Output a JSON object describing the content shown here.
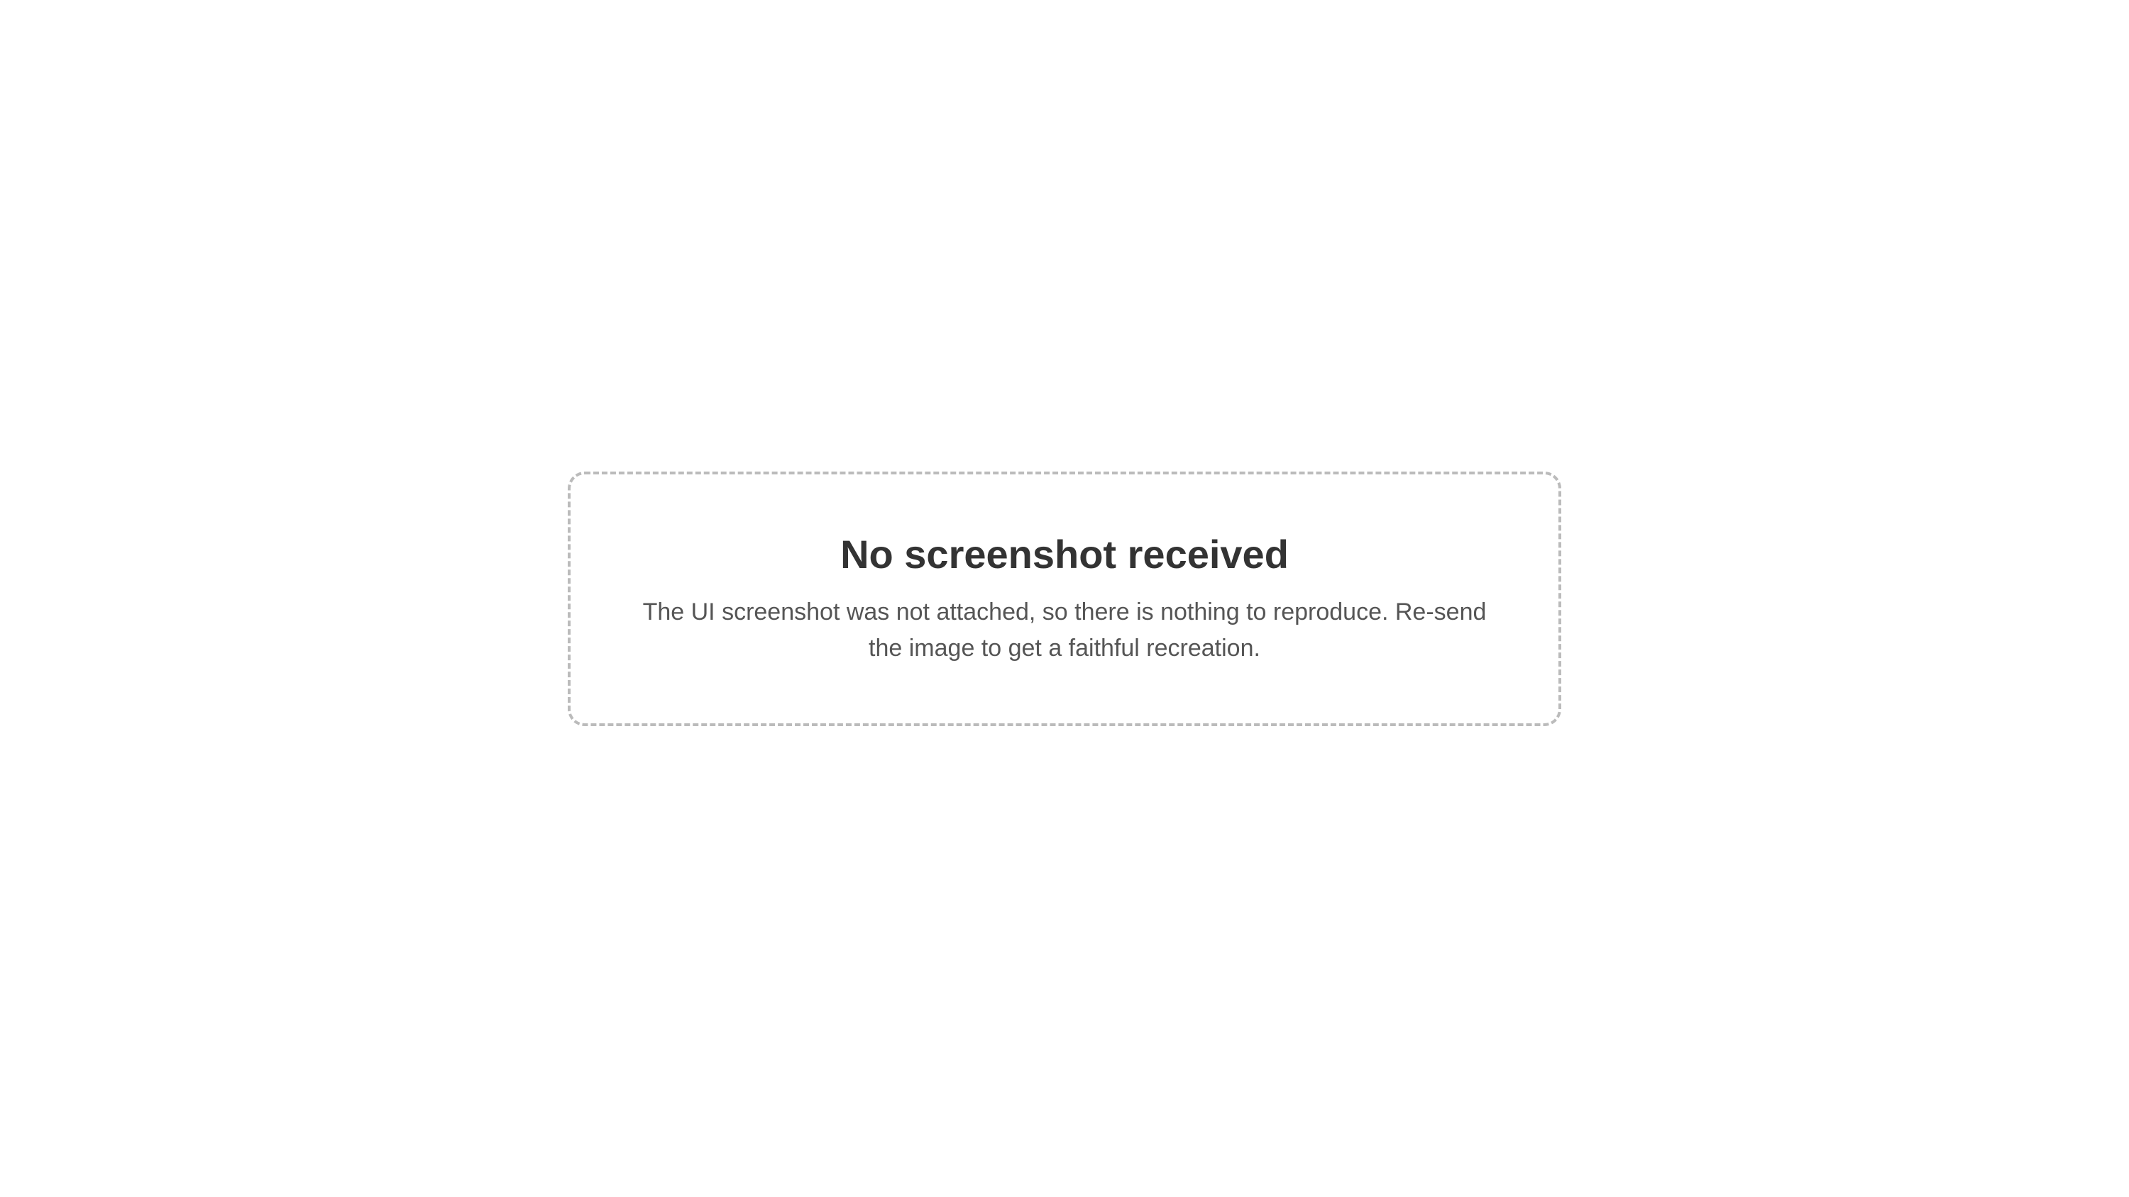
{
  "notice": {
    "title": "No screenshot received",
    "message": "The UI screenshot was not attached, so there is nothing to reproduce. Re-send the image to get a faithful recreation."
  }
}
